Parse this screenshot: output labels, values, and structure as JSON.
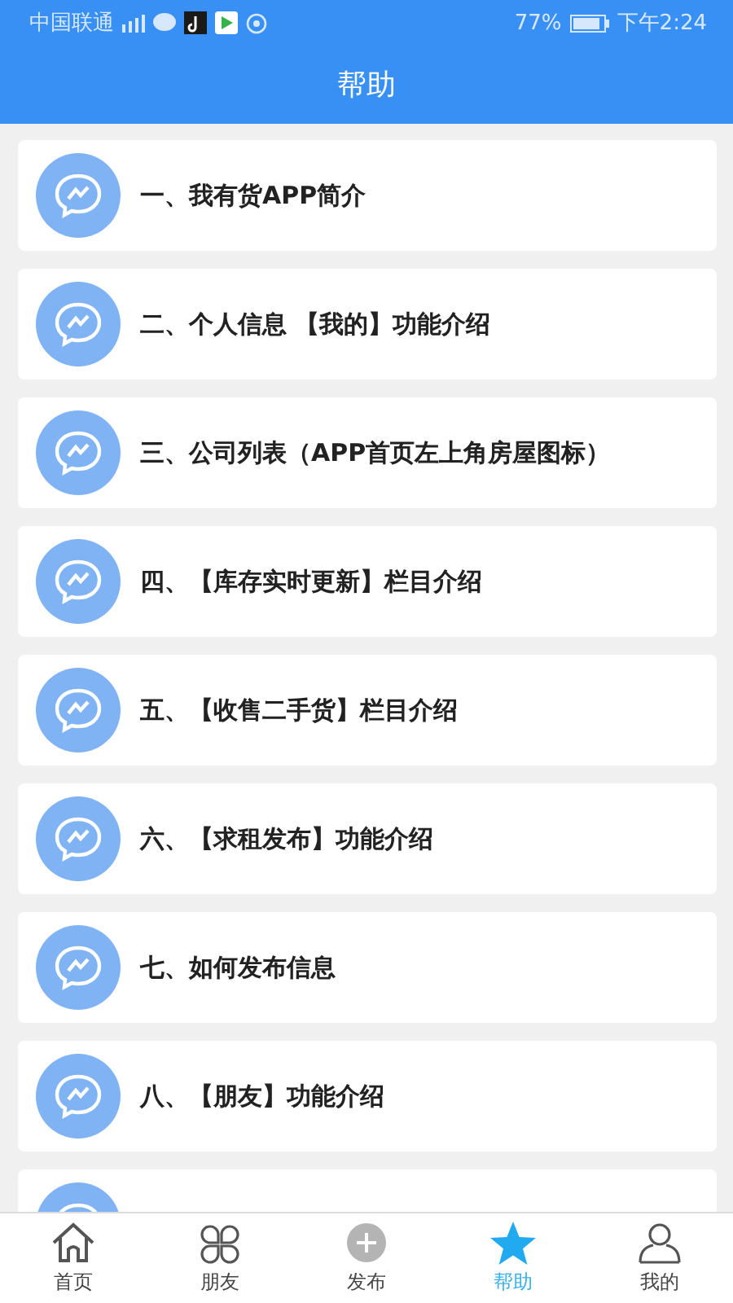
{
  "status_bar": {
    "carrier": "中国联通",
    "battery": "77%",
    "time": "下午2:24"
  },
  "header": {
    "title": "帮助"
  },
  "items": [
    {
      "title": "一、我有货APP简介"
    },
    {
      "title": "二、个人信息 【我的】功能介绍"
    },
    {
      "title": "三、公司列表（APP首页左上角房屋图标）"
    },
    {
      "title": "四、【库存实时更新】栏目介绍"
    },
    {
      "title": "五、【收售二手货】栏目介绍"
    },
    {
      "title": "六、【求租发布】功能介绍"
    },
    {
      "title": "七、如何发布信息"
    },
    {
      "title": "八、【朋友】功能介绍"
    },
    {
      "kind": "partial"
    }
  ],
  "nav": [
    {
      "kind": "home",
      "label": "首页",
      "selected": false
    },
    {
      "kind": "friends",
      "label": "朋友",
      "selected": false
    },
    {
      "kind": "publish",
      "label": "发布",
      "selected": false
    },
    {
      "kind": "help",
      "label": "帮助",
      "selected": true
    },
    {
      "kind": "me",
      "label": "我的",
      "selected": false
    }
  ]
}
